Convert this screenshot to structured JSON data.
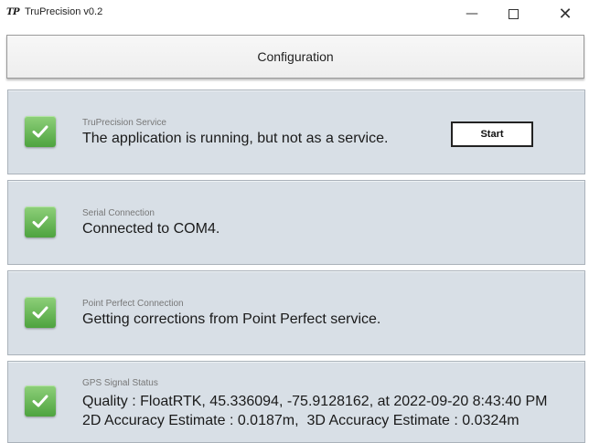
{
  "window": {
    "logo": "TP",
    "title": "TruPrecision v0.2",
    "minimize_glyph": "—",
    "close_glyph": "✕"
  },
  "header": {
    "label": "Configuration"
  },
  "panels": [
    {
      "label": "TruPrecision Service",
      "message": "The application is running, but not as a service.",
      "status_icon": "check-icon",
      "button_label": "Start"
    },
    {
      "label": "Serial Connection",
      "message": "Connected to COM4.",
      "status_icon": "check-icon"
    },
    {
      "label": "Point Perfect Connection",
      "message": "Getting corrections from Point Perfect service.",
      "status_icon": "check-icon"
    },
    {
      "label": "GPS Signal Status",
      "line1": "Quality : FloatRTK, 45.336094, -75.9128162, at 2022-09-20 8:43:40 PM",
      "line2": "2D Accuracy Estimate : 0.0187m,  3D Accuracy Estimate : 0.0324m",
      "status_icon": "check-icon"
    }
  ],
  "colors": {
    "panel_bg": "#d8dfe6",
    "check_green": "#5cb84a"
  }
}
